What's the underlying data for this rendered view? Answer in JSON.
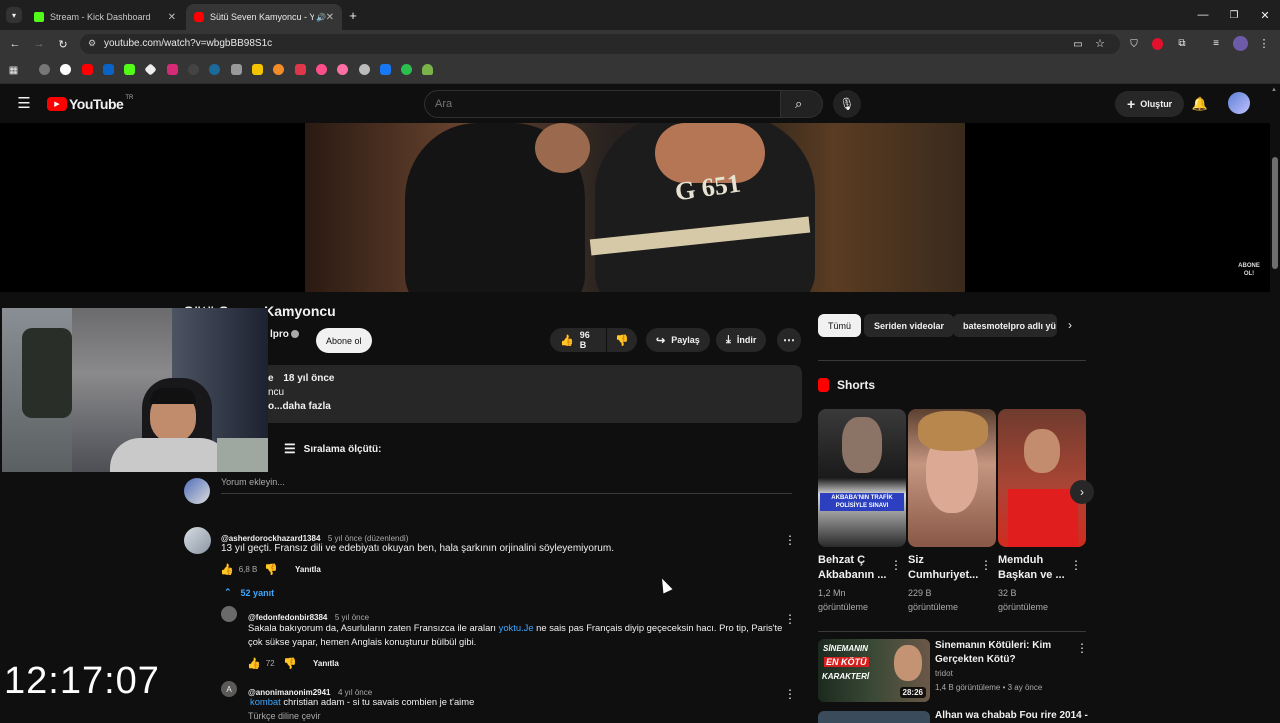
{
  "browser": {
    "tabs": [
      {
        "title": "Stream - Kick Dashboard"
      },
      {
        "title": "Sütü Seven Kamyoncu - YouTube"
      }
    ],
    "url": "youtube.com/watch?v=wbgbBB98S1c"
  },
  "youtube": {
    "logo_text": "YouTube",
    "logo_region": "TR",
    "search_placeholder": "Ara",
    "create_label": "Oluştur"
  },
  "video": {
    "title_visible": "Sütü Seven Kamyoncu",
    "channel_fragment": "lpro",
    "subscribe_label": "Abone ol",
    "likes": "96 B",
    "share_label": "Paylaş",
    "download_label": "İndir",
    "overlay_text": "ABONE OL!",
    "jersey_text": "G 651"
  },
  "description": {
    "line1_fragment": "e",
    "time": "18 yıl önce",
    "line2_fragment": "ncu",
    "line3_fragment": "o...daha fazla"
  },
  "comments": {
    "sort_label": "Sıralama ölçütü:",
    "add_placeholder": "Yorum ekleyin...",
    "items": [
      {
        "author": "@asherdorockhazard1384",
        "time": "5 yıl önce (düzenlendi)",
        "text": "13 yıl geçti. Fransız dili ve edebiyatı okuyan ben, hala  şarkının orjinalini söyleyemiyorum.",
        "likes": "6,8 B",
        "reply": "Yanıtla",
        "replies_label": "52 yanıt"
      },
      {
        "author": "@fedonfedonbir8384",
        "time": "5 yıl önce",
        "text_before": "Sakala bakıyorum da, Asurluların zaten Fransızca ile araları ",
        "link": "yoktu.Je",
        "text_after": " ne sais pas Français diyip geçeceksin hacı. Pro tip, Paris'te",
        "text2": "çok sükse yapar, hemen Anglais konuşturur bülbül gibi.",
        "likes": "72",
        "reply": "Yanıtla"
      },
      {
        "author": "@anonimanonim2941",
        "time": "4 yıl önce",
        "mention": "kombat",
        "text": " christian adam - si tu savais combien je t'aime",
        "extra": "Türkçe diline çevir"
      }
    ]
  },
  "sidebar": {
    "chips": [
      "Tümü",
      "Seriden videolar",
      "batesmotelpro adlı yü"
    ],
    "shorts_label": "Shorts",
    "shorts": [
      {
        "title1": "Behzat Ç",
        "title2": "Akbabanın ...",
        "views1": "1,2 Mn",
        "views2": "görüntüleme",
        "caption": "AKBABA'NIN TRAFİK POLİSİYLE SINAVI"
      },
      {
        "title1": "Siz",
        "title2": "Cumhuriyet...",
        "views1": "229 B",
        "views2": "görüntüleme"
      },
      {
        "title1": "Memduh",
        "title2": "Başkan ve ...",
        "views1": "32 B",
        "views2": "görüntüleme"
      }
    ],
    "video": {
      "title1": "Sinemanın Kötüleri: Kim",
      "title2": "Gerçekten Kötü?",
      "channel": "tridot",
      "meta": "1,4 B görüntüleme • 3 ay önce",
      "duration": "28:26",
      "thumb_text1": "SİNEMANIN",
      "thumb_text2": "EN KÖTÜ",
      "thumb_text3": "KARAKTERİ"
    },
    "video2_title": "Alhan wa chabab Fou rire 2014 -"
  },
  "overlay": {
    "clock": "12:17:07"
  },
  "colors": {
    "bg": "#0f0f0f",
    "chip": "#272727",
    "accent_red": "#ff0000",
    "link": "#3ea6ff"
  }
}
